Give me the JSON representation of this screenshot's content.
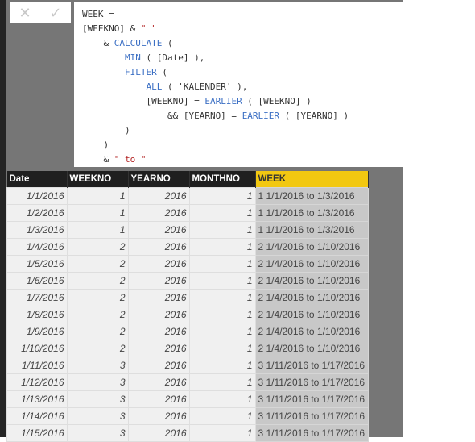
{
  "formula_bar": {
    "cancel_icon": "x-icon",
    "commit_icon": "check-icon",
    "lines": [
      [
        {
          "t": "WEEK ="
        }
      ],
      [
        {
          "t": "[WEEKNO] & "
        },
        {
          "t": "\" \"",
          "c": "str"
        }
      ],
      [
        {
          "t": "    & "
        },
        {
          "t": "CALCULATE",
          "c": "kw"
        },
        {
          "t": " ("
        }
      ],
      [
        {
          "t": "        "
        },
        {
          "t": "MIN",
          "c": "kw"
        },
        {
          "t": " ( [Date] ),"
        }
      ],
      [
        {
          "t": "        "
        },
        {
          "t": "FILTER",
          "c": "kw"
        },
        {
          "t": " ("
        }
      ],
      [
        {
          "t": "            "
        },
        {
          "t": "ALL",
          "c": "kw"
        },
        {
          "t": " ( 'KALENDER' ),"
        }
      ],
      [
        {
          "t": "            [WEEKNO] = "
        },
        {
          "t": "EARLIER",
          "c": "kw"
        },
        {
          "t": " ( [WEEKNO] )"
        }
      ],
      [
        {
          "t": "                && [YEARNO] = "
        },
        {
          "t": "EARLIER",
          "c": "kw"
        },
        {
          "t": " ( [YEARNO] )"
        }
      ],
      [
        {
          "t": "        )"
        }
      ],
      [
        {
          "t": "    )"
        }
      ],
      [
        {
          "t": "    & "
        },
        {
          "t": "\" to \"",
          "c": "str"
        }
      ]
    ]
  },
  "table": {
    "columns": [
      "Date",
      "WEEKNO",
      "YEARNO",
      "MONTHNO",
      "WEEK"
    ],
    "selected_column": "WEEK",
    "accent": "#f2c811",
    "rows": [
      [
        "1/1/2016",
        "1",
        "2016",
        "1",
        "1 1/1/2016 to 1/3/2016"
      ],
      [
        "1/2/2016",
        "1",
        "2016",
        "1",
        "1 1/1/2016 to 1/3/2016"
      ],
      [
        "1/3/2016",
        "1",
        "2016",
        "1",
        "1 1/1/2016 to 1/3/2016"
      ],
      [
        "1/4/2016",
        "2",
        "2016",
        "1",
        "2 1/4/2016 to 1/10/2016"
      ],
      [
        "1/5/2016",
        "2",
        "2016",
        "1",
        "2 1/4/2016 to 1/10/2016"
      ],
      [
        "1/6/2016",
        "2",
        "2016",
        "1",
        "2 1/4/2016 to 1/10/2016"
      ],
      [
        "1/7/2016",
        "2",
        "2016",
        "1",
        "2 1/4/2016 to 1/10/2016"
      ],
      [
        "1/8/2016",
        "2",
        "2016",
        "1",
        "2 1/4/2016 to 1/10/2016"
      ],
      [
        "1/9/2016",
        "2",
        "2016",
        "1",
        "2 1/4/2016 to 1/10/2016"
      ],
      [
        "1/10/2016",
        "2",
        "2016",
        "1",
        "2 1/4/2016 to 1/10/2016"
      ],
      [
        "1/11/2016",
        "3",
        "2016",
        "1",
        "3 1/11/2016 to 1/17/2016"
      ],
      [
        "1/12/2016",
        "3",
        "2016",
        "1",
        "3 1/11/2016 to 1/17/2016"
      ],
      [
        "1/13/2016",
        "3",
        "2016",
        "1",
        "3 1/11/2016 to 1/17/2016"
      ],
      [
        "1/14/2016",
        "3",
        "2016",
        "1",
        "3 1/11/2016 to 1/17/2016"
      ],
      [
        "1/15/2016",
        "3",
        "2016",
        "1",
        "3 1/11/2016 to 1/17/2016"
      ]
    ]
  }
}
